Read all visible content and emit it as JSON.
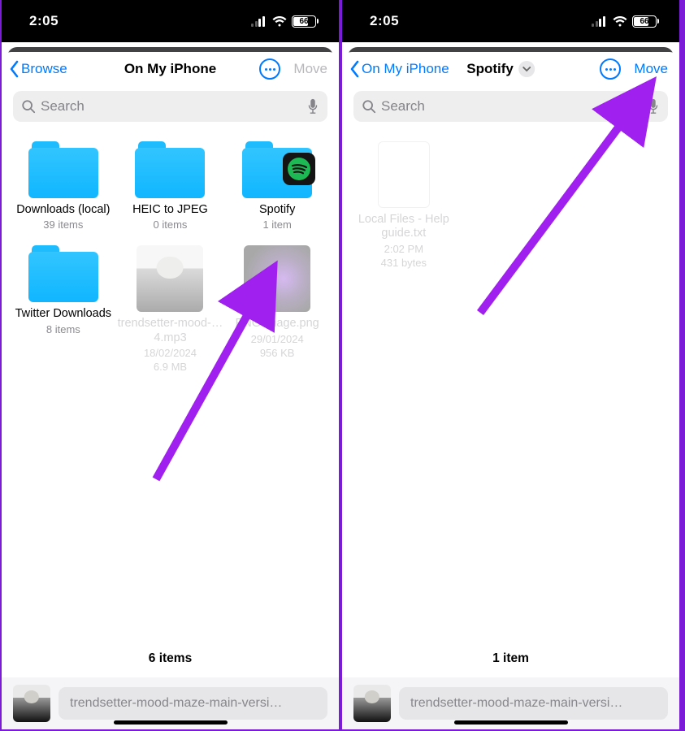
{
  "statusbar": {
    "time": "2:05",
    "battery": "66"
  },
  "left": {
    "back_label": "Browse",
    "title": "On My iPhone",
    "move_label": "Move",
    "move_enabled": false,
    "search_placeholder": "Search",
    "items": [
      {
        "name": "Downloads (local)",
        "sub": "39 items",
        "kind": "folder"
      },
      {
        "name": "HEIC to JPEG",
        "sub": "0 items",
        "kind": "folder"
      },
      {
        "name": "Spotify",
        "sub": "1 item",
        "kind": "folder",
        "badge": "spotify"
      },
      {
        "name": "Twitter Downloads",
        "sub": "8 items",
        "kind": "folder"
      },
      {
        "name": "trendsetter-mood-…4.mp3",
        "sub": "18/02/2024",
        "sub2": "6.9 MB",
        "kind": "file-person",
        "faded": true
      },
      {
        "name": "PNG image.png",
        "sub": "29/01/2024",
        "sub2": "956 KB",
        "kind": "file-dark",
        "faded": true
      }
    ],
    "count": "6 items",
    "moving_file": "trendsetter-mood-maze-main-versi…"
  },
  "right": {
    "back_label": "On My iPhone",
    "title": "Spotify",
    "move_label": "Move",
    "move_enabled": true,
    "search_placeholder": "Search",
    "items": [
      {
        "name": "Local Files - Help guide.txt",
        "sub": "2:02 PM",
        "sub2": "431 bytes",
        "kind": "file-doc",
        "faded": true
      }
    ],
    "count": "1 item",
    "moving_file": "trendsetter-mood-maze-main-versi…"
  }
}
